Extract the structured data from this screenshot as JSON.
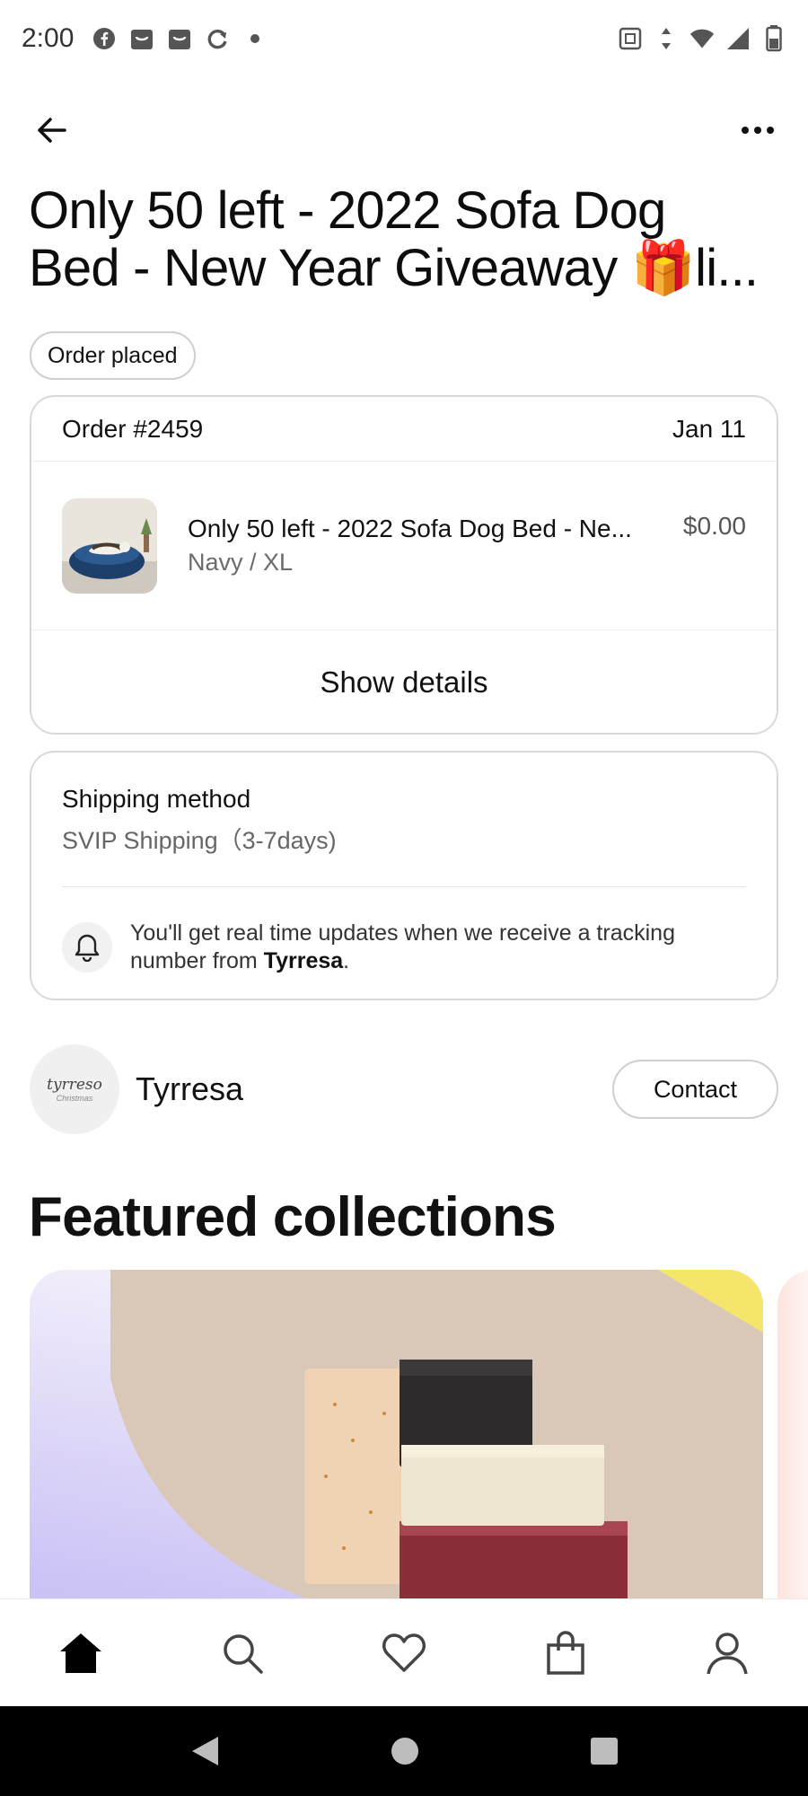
{
  "status_bar": {
    "time": "2:00",
    "left_icons": [
      "facebook-icon",
      "shop-icon",
      "shop-icon",
      "sync-icon",
      "dot-icon"
    ],
    "right_icons": [
      "nfc-icon",
      "data-arrows-icon",
      "wifi-icon",
      "signal-icon",
      "battery-icon"
    ]
  },
  "header": {
    "back_icon": "arrow-left-icon",
    "more_icon": "more-horizontal-icon"
  },
  "title": {
    "line1": "Only 50 left - 2022 Sofa Dog",
    "line2": "Bed - New Year Giveaway 🎁li..."
  },
  "order_status": "Order placed",
  "order": {
    "number": "Order #2459",
    "date": "Jan 11",
    "item": {
      "name": "Only 50 left - 2022 Sofa Dog Bed - Ne...",
      "variant": "Navy / XL",
      "price": "$0.00"
    },
    "show_details_label": "Show details"
  },
  "shipping": {
    "title": "Shipping method",
    "method": "SVIP Shipping（3-7days)",
    "note_prefix": "You'll get real time updates when we receive a tracking number from ",
    "note_shop": "Tyrresa",
    "note_suffix": "."
  },
  "shop": {
    "logo_text": "tyrreso",
    "logo_sub": "Christmas",
    "name": "Tyrresa",
    "contact_label": "Contact"
  },
  "featured": {
    "title": "Featured collections"
  },
  "bottom_nav": {
    "items": [
      "home-icon",
      "search-icon",
      "heart-icon",
      "bag-icon",
      "profile-icon"
    ]
  },
  "colors": {
    "text": "#111111",
    "muted": "#6b6b6b",
    "border": "#d9d9d9"
  }
}
